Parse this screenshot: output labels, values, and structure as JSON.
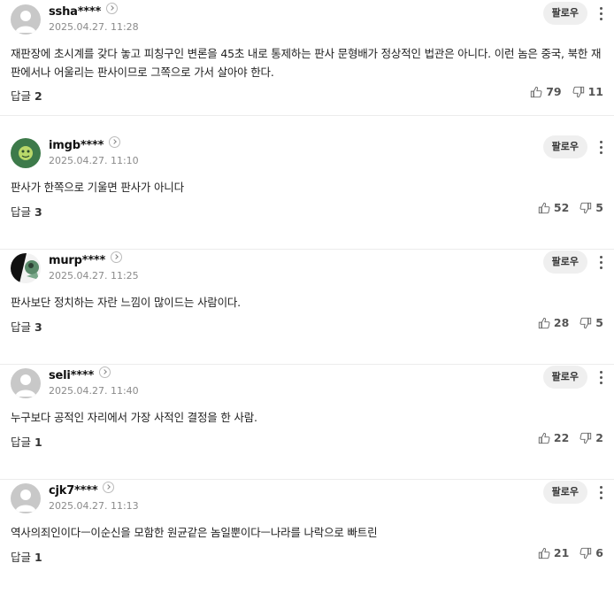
{
  "follow_label": "팔로우",
  "reply_label": "답글",
  "comments": [
    {
      "nick": "ssha****",
      "date": "2025.04.27. 11:28",
      "text": "재판장에 초시계를 갖다 놓고 피칭구인 변론을 45초 내로 통제하는 판사 문형배가 정상적인 법관은 아니다. 이런 놈은 중국, 북한 재판에서나 어울리는 판사이므로 그쪽으로 가서 살아야 한다.",
      "replies": "2",
      "likes": "79",
      "dislikes": "11"
    },
    {
      "nick": "imgb****",
      "date": "2025.04.27. 11:10",
      "text": "판사가 한쪽으로 기울면 판사가 아니다",
      "replies": "3",
      "likes": "52",
      "dislikes": "5"
    },
    {
      "nick": "murp****",
      "date": "2025.04.27. 11:25",
      "text": "판사보단 정치하는 자란 느낌이 많이드는 사람이다.",
      "replies": "3",
      "likes": "28",
      "dislikes": "5"
    },
    {
      "nick": "seli****",
      "date": "2025.04.27. 11:40",
      "text": "누구보다 공적인 자리에서 가장 사적인 결정을 한 사람.",
      "replies": "1",
      "likes": "22",
      "dislikes": "2"
    },
    {
      "nick": "cjk7****",
      "date": "2025.04.27. 11:13",
      "text": "역사의죄인이다ㅡ이순신을 모함한 원균같은 놈일뿐이다ㅡ나라를 나락으로 빠트린",
      "replies": "1",
      "likes": "21",
      "dislikes": "6"
    }
  ]
}
